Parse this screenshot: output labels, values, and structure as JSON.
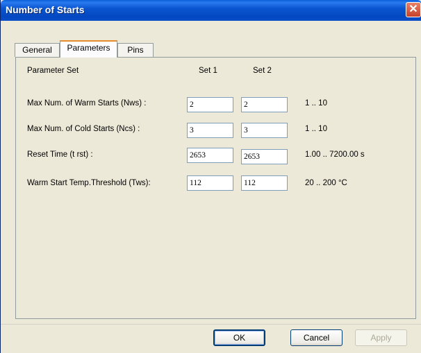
{
  "window": {
    "title": "Number of Starts",
    "close_glyph": "✕"
  },
  "tabs": [
    {
      "label": "General",
      "active": false
    },
    {
      "label": "Parameters",
      "active": true
    },
    {
      "label": "Pins",
      "active": false
    }
  ],
  "header": {
    "param_set": "Parameter Set",
    "set1": "Set 1",
    "set2": "Set 2"
  },
  "rows": [
    {
      "label": "Max Num. of Warm Starts (Nws) :",
      "set1": "2",
      "set2": "2",
      "range": "1 .. 10"
    },
    {
      "label": "Max Num. of Cold Starts (Ncs) :",
      "set1": "3",
      "set2": "3",
      "range": "1 .. 10"
    },
    {
      "label": "Reset Time (t rst) :",
      "set1": "2653",
      "set2": "2653",
      "range": "1.00 .. 7200.00 s"
    },
    {
      "label": "Warm Start Temp.Threshold (Tws):",
      "set1": "112",
      "set2": "112",
      "range": "20 .. 200 °C"
    }
  ],
  "buttons": {
    "ok": "OK",
    "cancel": "Cancel",
    "apply": "Apply"
  },
  "colors": {
    "titlebar": "#0a56d0",
    "close": "#c8412a",
    "face": "#ece9d8",
    "tab_highlight": "#e68b2c"
  }
}
